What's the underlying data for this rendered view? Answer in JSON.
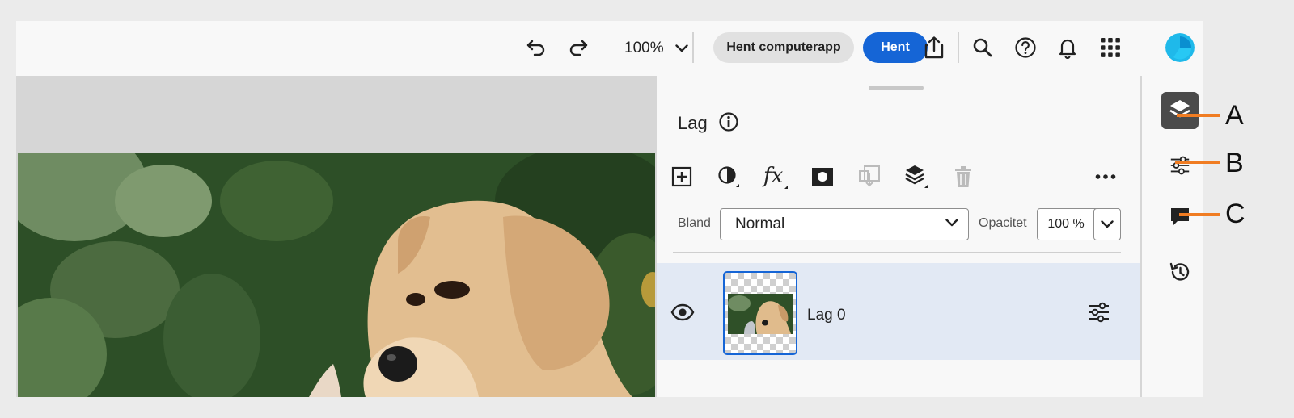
{
  "toolbar": {
    "zoom_value": "100%",
    "get_app_label": "Hent computerapp",
    "get_label": "Hent"
  },
  "panel": {
    "title": "Lag",
    "blend_label": "Bland",
    "blend_value": "Normal",
    "opacity_label": "Opacitet",
    "opacity_value": "100 %"
  },
  "layers": [
    {
      "name": "Lag 0",
      "visible": true,
      "selected": true
    }
  ],
  "rail": {
    "items": [
      "layers-icon",
      "adjustments-icon",
      "comment-icon",
      "history-icon"
    ]
  },
  "callouts": {
    "a": "A",
    "b": "B",
    "c": "C"
  },
  "colors": {
    "accent": "#1565d6",
    "callout": "#f07c22",
    "selected_row": "#e2e9f4"
  }
}
